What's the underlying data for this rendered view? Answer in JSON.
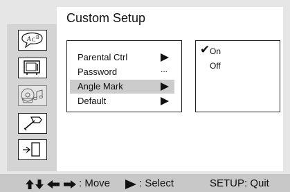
{
  "page_title": "Custom Setup",
  "rail_icons": [
    "language-icon",
    "video-icon",
    "audio-icon",
    "tools-icon",
    "exit-icon"
  ],
  "menu": {
    "items": [
      {
        "label": "Parental Ctrl",
        "indicator": "arrow"
      },
      {
        "label": "Password",
        "indicator": "..."
      },
      {
        "label": "Angle Mark",
        "indicator": "arrow",
        "selected": true
      },
      {
        "label": "Default",
        "indicator": "arrow"
      }
    ]
  },
  "submenu": {
    "check_glyph": "✔",
    "options": [
      {
        "label": "On",
        "checked": true
      },
      {
        "label": "Off",
        "checked": false
      }
    ]
  },
  "footer": {
    "move_label": ": Move",
    "select_label": ": Select",
    "quit_label": "SETUP: Quit"
  }
}
